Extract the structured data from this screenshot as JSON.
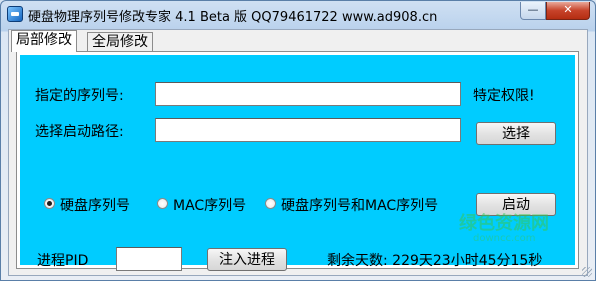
{
  "window": {
    "title": "硬盘物理序列号修改专家 4.1 Beta 版 QQ79461722 www.ad908.cn",
    "minimize_label": "—",
    "close_label": "✕"
  },
  "tabs": [
    {
      "label": "局部修改",
      "selected": true
    },
    {
      "label": "全局修改",
      "selected": false
    }
  ],
  "form": {
    "serial_label": "指定的序列号:",
    "serial_value": "",
    "special_rights_label": "特定权限!",
    "path_label": "选择启动路径:",
    "path_value": "",
    "browse_button": "选择",
    "options": [
      {
        "label": "硬盘序列号",
        "selected": true
      },
      {
        "label": "MAC序列号",
        "selected": false
      },
      {
        "label": "硬盘序列号和MAC序列号",
        "selected": false
      }
    ],
    "start_button": "启动",
    "pid_label": "进程PID",
    "pid_value": "",
    "inject_button": "注入进程",
    "remaining_time": "剩余天数: 229天23小时45分15秒"
  },
  "watermark": {
    "text": "绿色资源网",
    "url": "downcc.com"
  },
  "colors": {
    "panel_bg": "#00ccff",
    "window_frame": "#b9d1ec",
    "close_button": "#c7432a"
  }
}
